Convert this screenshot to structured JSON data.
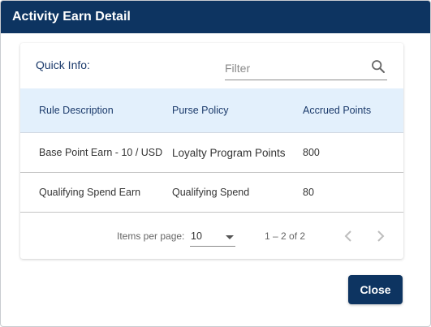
{
  "dialog": {
    "title": "Activity Earn Detail"
  },
  "quick_info": {
    "label": "Quick Info:"
  },
  "filter": {
    "placeholder": "Filter",
    "value": ""
  },
  "table": {
    "columns": [
      "Rule Description",
      "Purse Policy",
      "Accrued Points"
    ],
    "rows": [
      [
        "Base Point Earn - 10 / USD",
        "Loyalty Program Points",
        "800"
      ],
      [
        "Qualifying Spend Earn",
        "Qualifying Spend",
        "80"
      ]
    ]
  },
  "paginator": {
    "items_per_page_label": "Items per page:",
    "items_per_page_value": "10",
    "range_label": "1 – 2 of 2"
  },
  "actions": {
    "close_label": "Close"
  },
  "colors": {
    "header_bg": "#0d3461",
    "table_header_bg": "#e3f0fc",
    "accent_text": "#1b3a6b"
  },
  "icons": {
    "search": "search-icon",
    "dropdown": "chevron-down-icon",
    "prev": "chevron-left-icon",
    "next": "chevron-right-icon"
  }
}
